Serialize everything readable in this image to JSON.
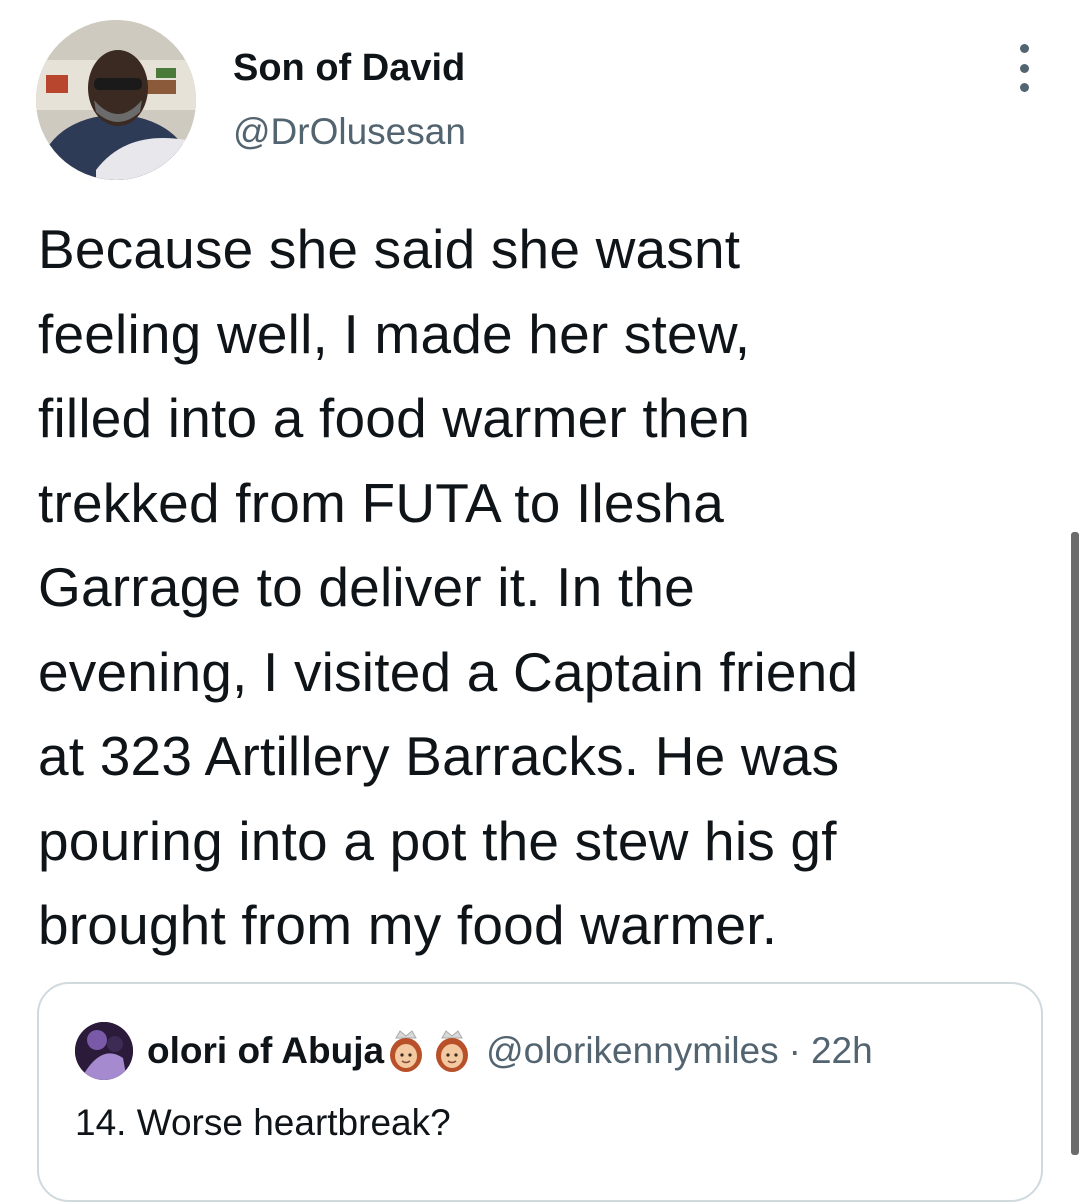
{
  "author": {
    "display_name": "Son of David",
    "handle": "@DrOlusesan",
    "avatar_icon": "profile-photo"
  },
  "more_icon": "more-options-icon",
  "tweet": {
    "text": "Because she said she wasnt\nfeeling well, I made her stew,\nfilled into a food warmer then\ntrekked from FUTA to Ilesha\nGarrage to deliver it. In the\nevening, I visited a Captain friend\nat 323 Artillery Barracks. He was\npouring into a pot the stew his gf\nbrought from my food warmer."
  },
  "quoted_tweet": {
    "display_name": "olori of Abuja",
    "emojis": [
      "princess-emoji",
      "princess-emoji"
    ],
    "handle": "@olorikennymiles",
    "separator": "·",
    "time": "22h",
    "text": "14. Worse heartbreak?"
  },
  "colors": {
    "text_primary": "#0f1419",
    "text_secondary": "#536471",
    "border": "#cfd9de"
  }
}
